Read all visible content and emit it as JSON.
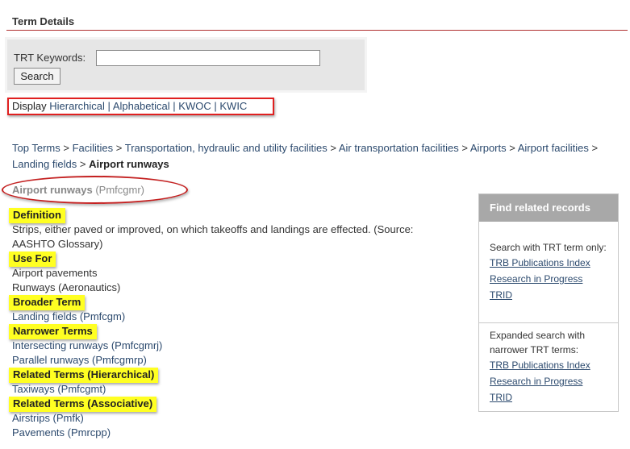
{
  "page": {
    "title": "Term Details"
  },
  "search": {
    "label": "TRT Keywords:",
    "value": "",
    "button": "Search"
  },
  "display": {
    "label": "Display",
    "options": [
      "Hierarchical",
      "Alphabetical",
      "KWOC",
      "KWIC"
    ],
    "separator": "|"
  },
  "breadcrumb": {
    "items": [
      "Top Terms",
      "Facilities",
      "Transportation, hydraulic and utility facilities",
      "Air transportation facilities",
      "Airports",
      "Airport facilities",
      "Landing fields"
    ],
    "current": "Airport runways",
    "separator": ">"
  },
  "term": {
    "name": "Airport runways",
    "code": "(Pmfcgmr)"
  },
  "sections": {
    "definition": {
      "label": "Definition",
      "line1": "Strips, either paved or improved, on which takeoffs and landings are effected. (Source:",
      "line2": "AASHTO Glossary)"
    },
    "use_for": {
      "label": "Use For",
      "items": [
        "Airport pavements",
        "Runways (Aeronautics)"
      ]
    },
    "broader": {
      "label": "Broader Term",
      "items": [
        "Landing fields (Pmfcgm)"
      ]
    },
    "narrower": {
      "label": "Narrower Terms",
      "items": [
        "Intersecting runways (Pmfcgmrj)",
        "Parallel runways (Pmfcgmrp)"
      ]
    },
    "related_hier": {
      "label": "Related Terms (Hierarchical)",
      "items": [
        "Taxiways (Pmfcgmt)"
      ]
    },
    "related_assoc": {
      "label": "Related Terms (Associative)",
      "items": [
        "Airstrips (Pmfk)",
        "Pavements (Pmrcpp)"
      ]
    }
  },
  "related": {
    "header": "Find related records",
    "trt_only": {
      "label": "Search with TRT term only:",
      "links": [
        "TRB Publications Index",
        "Research in Progress",
        "TRID"
      ]
    },
    "expanded": {
      "label_line1": "Expanded search with",
      "label_line2": "narrower TRT terms:",
      "links": [
        "TRB Publications Index",
        "Research in Progress",
        "TRID"
      ]
    }
  },
  "colors": {
    "accent_red": "#e02020",
    "highlight": "#ffff22",
    "link": "#2c4a6e",
    "panel_gray": "#e6e6e6"
  }
}
